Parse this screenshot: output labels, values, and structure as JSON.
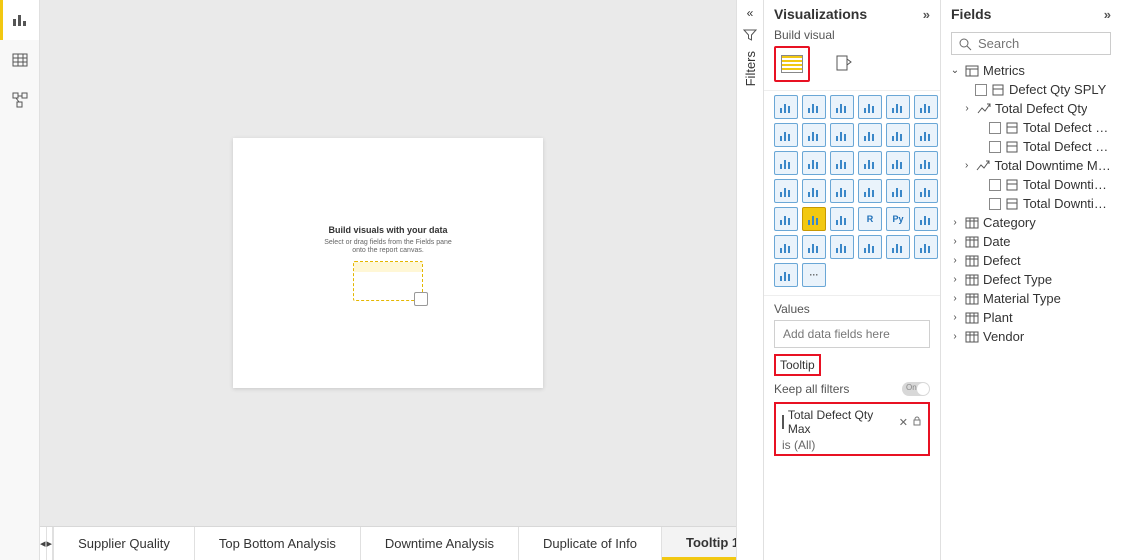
{
  "colors": {
    "accent": "#f2c811",
    "highlight": "#e81123"
  },
  "left_rail": {
    "items": [
      "report-view",
      "data-view",
      "model-view"
    ],
    "active": 0
  },
  "canvas": {
    "placeholder_title": "Build visuals with your data",
    "placeholder_sub": "Select or drag fields from the Fields pane onto the report canvas."
  },
  "tabs": {
    "items": [
      "Supplier Quality",
      "Top Bottom Analysis",
      "Downtime Analysis",
      "Duplicate of Info",
      "Tooltip 1"
    ],
    "active_index": 4,
    "add_label": "+"
  },
  "filters_pane": {
    "label": "Filters"
  },
  "visualizations": {
    "title": "Visualizations",
    "subtitle": "Build visual",
    "modes": [
      "build",
      "format"
    ],
    "active_mode": 0,
    "values_label": "Values",
    "values_placeholder": "Add data fields here",
    "tooltip_label": "Tooltip",
    "keep_filters_label": "Keep all filters",
    "keep_filters_on_text": "On",
    "tooltip_field": {
      "name": "Total Defect Qty Max",
      "summary": "is (All)"
    },
    "gallery": [
      "stacked-bar",
      "clustered-bar",
      "stacked-column",
      "clustered-column",
      "stacked-bar-100",
      "clustered-column-100",
      "line",
      "area",
      "stacked-area",
      "line-col",
      "line-col2",
      "ribbon",
      "waterfall",
      "funnel",
      "scatter",
      "pie",
      "donut",
      "treemap",
      "map",
      "filled-map",
      "arcgis",
      "card",
      "multi-card",
      "kpi",
      "slicer",
      "table",
      "matrix",
      "r",
      "py",
      "key-infl",
      "decomp",
      "qna",
      "paginated",
      "score",
      "narrative",
      "get-more",
      "power-apps",
      "more"
    ],
    "selected_gallery_index": 25
  },
  "fields": {
    "title": "Fields",
    "search_placeholder": "Search",
    "tree": {
      "metrics": {
        "label": "Metrics",
        "items": [
          {
            "type": "measure",
            "label": "Defect Qty SPLY"
          },
          {
            "type": "hierarchy",
            "label": "Total Defect Qty",
            "children": [
              {
                "type": "measure",
                "label": "Total Defect Qty ..."
              },
              {
                "type": "measure",
                "label": "Total Defect Rep..."
              }
            ]
          },
          {
            "type": "hierarchy",
            "label": "Total Downtime Min...",
            "children": [
              {
                "type": "measure",
                "label": "Total Downtime ..."
              },
              {
                "type": "measure",
                "label": "Total Downtime ..."
              }
            ]
          }
        ]
      },
      "tables": [
        "Category",
        "Date",
        "Defect",
        "Defect Type",
        "Material Type",
        "Plant",
        "Vendor"
      ]
    }
  }
}
